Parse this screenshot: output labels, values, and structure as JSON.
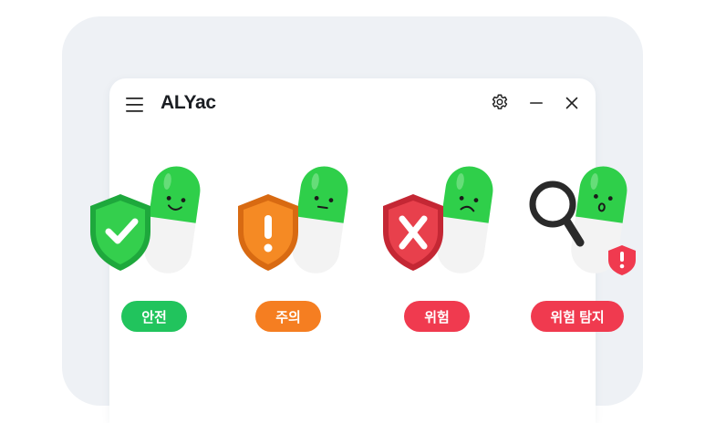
{
  "app": {
    "title": "ALYac",
    "menu_icon": "hamburger-menu-icon",
    "controls": {
      "settings_icon": "gear-icon",
      "minimize_icon": "minimize-icon",
      "close_icon": "close-icon"
    }
  },
  "statuses": [
    {
      "label": "안전",
      "icon": "green-shield-check-icon",
      "color": "#21c45d"
    },
    {
      "label": "주의",
      "icon": "orange-shield-exclamation-icon",
      "color": "#f57e21"
    },
    {
      "label": "위험",
      "icon": "red-shield-x-icon",
      "color": "#f03a4f"
    },
    {
      "label": "위험 탐지",
      "icon": "magnifier-detection-icon",
      "color": "#f03a4f"
    }
  ],
  "colors": {
    "background": "#eef1f5",
    "window": "#ffffff",
    "capsule_green": "#2fcf4a",
    "capsule_white": "#f2f2f2"
  }
}
